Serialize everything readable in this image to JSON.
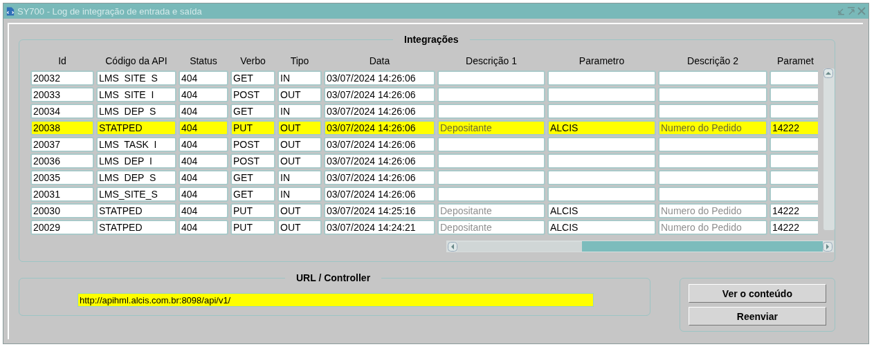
{
  "window": {
    "title": "SY700 - Log de integração de entrada e saída"
  },
  "integracoes": {
    "title": "Integrações",
    "columns": [
      {
        "label": "Id",
        "kind": "text"
      },
      {
        "label": "Código da API",
        "kind": "text"
      },
      {
        "label": "Status",
        "kind": "text"
      },
      {
        "label": "Verbo",
        "kind": "text"
      },
      {
        "label": "Tipo",
        "kind": "text"
      },
      {
        "label": "Data",
        "kind": "text"
      },
      {
        "label": "Descrição 1",
        "kind": "caption"
      },
      {
        "label": "Parametro",
        "kind": "text"
      },
      {
        "label": "Descrição 2",
        "kind": "caption"
      },
      {
        "label": "Paramet",
        "kind": "text"
      }
    ],
    "rows": [
      {
        "selected": false,
        "cells": [
          "20032",
          "LMS  SITE  S",
          "404",
          "GET",
          "IN",
          "03/07/2024 14:26:06",
          null,
          null,
          null,
          null
        ]
      },
      {
        "selected": false,
        "cells": [
          "20033",
          "LMS  SITE  I",
          "404",
          "POST",
          "OUT",
          "03/07/2024 14:26:06",
          null,
          null,
          null,
          null
        ]
      },
      {
        "selected": false,
        "cells": [
          "20034",
          "LMS  DEP  S",
          "404",
          "GET",
          "IN",
          "03/07/2024 14:26:06",
          null,
          null,
          null,
          null
        ]
      },
      {
        "selected": true,
        "cells": [
          "20038",
          "STATPED",
          "404",
          "PUT",
          "OUT",
          "03/07/2024 14:26:06",
          "Depositante",
          "ALCIS",
          "Numero do Pedido",
          "14222"
        ]
      },
      {
        "selected": false,
        "cells": [
          "20037",
          "LMS  TASK  I",
          "404",
          "POST",
          "OUT",
          "03/07/2024 14:26:06",
          null,
          null,
          null,
          null
        ]
      },
      {
        "selected": false,
        "cells": [
          "20036",
          "LMS  DEP  I",
          "404",
          "POST",
          "OUT",
          "03/07/2024 14:26:06",
          null,
          null,
          null,
          null
        ]
      },
      {
        "selected": false,
        "cells": [
          "20035",
          "LMS  DEP  S",
          "404",
          "GET",
          "IN",
          "03/07/2024 14:26:06",
          null,
          null,
          null,
          null
        ]
      },
      {
        "selected": false,
        "cells": [
          "20031",
          "LMS_SITE_S",
          "404",
          "GET",
          "IN",
          "03/07/2024 14:26:06",
          null,
          null,
          null,
          null
        ]
      },
      {
        "selected": false,
        "cells": [
          "20030",
          "STATPED",
          "404",
          "PUT",
          "OUT",
          "03/07/2024 14:25:16",
          "Depositante",
          "ALCIS",
          "Numero do Pedido",
          "14222"
        ]
      },
      {
        "selected": false,
        "cells": [
          "20029",
          "STATPED",
          "404",
          "PUT",
          "OUT",
          "03/07/2024 14:24:21",
          "Depositante",
          "ALCIS",
          "Numero do Pedido",
          "14222"
        ]
      }
    ]
  },
  "url": {
    "title": "URL / Controller",
    "value": "http://apihml.alcis.com.br:8098/api/v1/"
  },
  "buttons": [
    "Ver o conteúdo",
    "Reenviar"
  ]
}
